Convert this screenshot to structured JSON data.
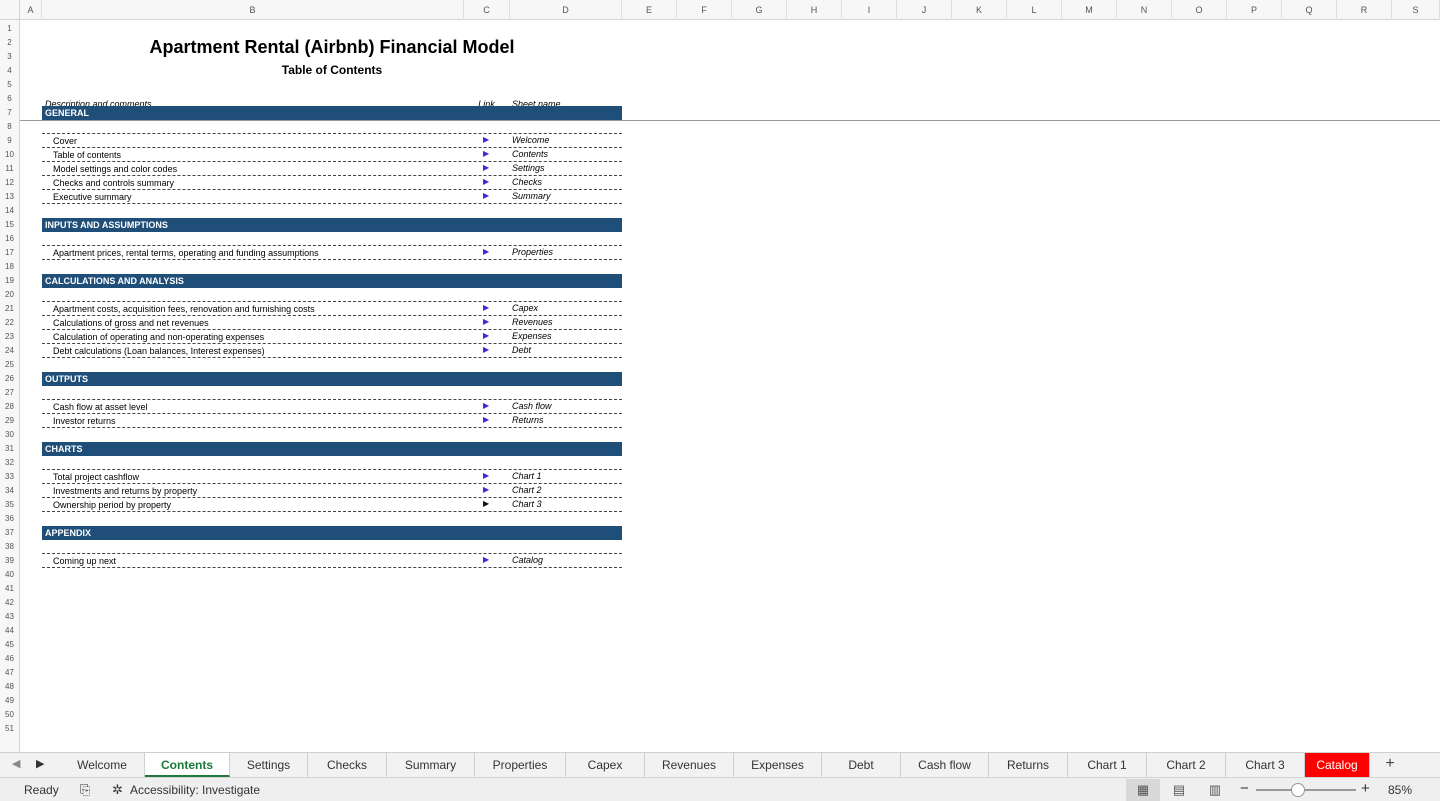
{
  "columns": [
    "A",
    "B",
    "C",
    "D",
    "E",
    "F",
    "G",
    "H",
    "I",
    "J",
    "K",
    "L",
    "M",
    "N",
    "O",
    "P",
    "Q",
    "R",
    "S"
  ],
  "rows": [
    "1",
    "2",
    "3",
    "4",
    "5",
    "6",
    "7",
    "8",
    "9",
    "10",
    "11",
    "12",
    "13",
    "14",
    "15",
    "16",
    "17",
    "18",
    "19",
    "20",
    "21",
    "22",
    "23",
    "24",
    "25",
    "26",
    "27",
    "28",
    "29",
    "30",
    "31",
    "32",
    "33",
    "34",
    "35",
    "36",
    "37",
    "38",
    "39",
    "40",
    "41",
    "42",
    "43",
    "44",
    "45",
    "46",
    "47",
    "48",
    "49",
    "50",
    "51"
  ],
  "sheet": {
    "title": "Apartment Rental (Airbnb) Financial Model",
    "subtitle": "Table of Contents",
    "headers": {
      "description": "Description and comments",
      "link": "Link",
      "sheet_name": "Sheet name"
    },
    "sections": [
      {
        "title": "GENERAL",
        "items": [
          {
            "desc": "Cover",
            "sheet": "Welcome"
          },
          {
            "desc": "Table of contents",
            "sheet": "Contents"
          },
          {
            "desc": "Model settings and color codes",
            "sheet": "Settings"
          },
          {
            "desc": "Checks and controls summary",
            "sheet": "Checks"
          },
          {
            "desc": "Executive summary",
            "sheet": "Summary"
          }
        ]
      },
      {
        "title": "INPUTS AND ASSUMPTIONS",
        "items": [
          {
            "desc": "Apartment prices, rental terms, operating and funding assumptions",
            "sheet": "Properties"
          }
        ]
      },
      {
        "title": "CALCULATIONS AND ANALYSIS",
        "items": [
          {
            "desc": "Apartment costs, acquisition fees, renovation and furnishing costs",
            "sheet": "Capex"
          },
          {
            "desc": "Calculations of gross and net revenues",
            "sheet": "Revenues"
          },
          {
            "desc": "Calculation of operating and non-operating expenses",
            "sheet": "Expenses"
          },
          {
            "desc": "Debt calculations (Loan balances, Interest expenses)",
            "sheet": "Debt"
          }
        ]
      },
      {
        "title": "OUTPUTS",
        "items": [
          {
            "desc": "Cash flow at asset level",
            "sheet": "Cash flow"
          },
          {
            "desc": "Investor returns",
            "sheet": "Returns"
          }
        ]
      },
      {
        "title": "CHARTS",
        "items": [
          {
            "desc": "Total project cashflow",
            "sheet": "Chart 1"
          },
          {
            "desc": "Investments and returns by property",
            "sheet": "Chart 2"
          },
          {
            "desc": "Ownership period by property",
            "sheet": "Chart 3"
          }
        ]
      },
      {
        "title": "APPENDIX",
        "items": [
          {
            "desc": "Coming up next",
            "sheet": "Catalog"
          }
        ]
      }
    ],
    "link_glyph": "▶"
  },
  "tabs": [
    "Welcome",
    "Contents",
    "Settings",
    "Checks",
    "Summary",
    "Properties",
    "Capex",
    "Revenues",
    "Expenses",
    "Debt",
    "Cash flow",
    "Returns",
    "Chart 1",
    "Chart 2",
    "Chart 3",
    "Catalog"
  ],
  "active_tab": "Contents",
  "status": {
    "ready": "Ready",
    "accessibility": "Accessibility: Investigate",
    "zoom": "85%"
  },
  "colors": {
    "section_bar": "#1f4e79",
    "active_tab": "#1b7a3a",
    "highlight_tab": "#ff0000",
    "link_arrow": "#3a2bd9"
  }
}
